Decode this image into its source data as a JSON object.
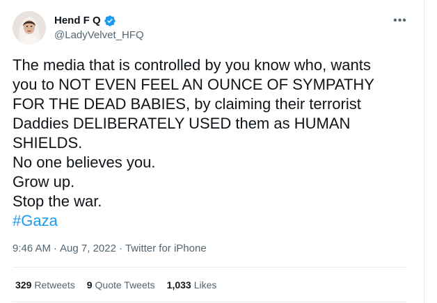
{
  "author": {
    "display_name": "Hend F Q",
    "handle": "@LadyVelvet_HFQ",
    "verified": true
  },
  "more_menu_label": "•••",
  "tweet": {
    "lines": [
      "The media that is controlled by you know who, wants",
      "you to NOT EVEN FEEL AN OUNCE OF SYMPATHY",
      "FOR THE DEAD BABIES, by claiming their terrorist",
      "Daddies DELIBERATELY USED them as HUMAN",
      "SHIELDS.",
      "No one believes you.",
      "Grow up.",
      "Stop the war."
    ],
    "hashtag": "#Gaza"
  },
  "meta": {
    "time": "9:46 AM",
    "separator": "·",
    "date": "Aug 7, 2022",
    "source": "Twitter for iPhone"
  },
  "stats": {
    "retweets_count": "329",
    "retweets_label": "Retweets",
    "quotes_count": "9",
    "quotes_label": "Quote Tweets",
    "likes_count": "1,033",
    "likes_label": "Likes"
  },
  "colors": {
    "accent": "#1d9bf0",
    "secondary_text": "#536471",
    "primary_text": "#0f1419",
    "divider": "#e6ecf0"
  }
}
